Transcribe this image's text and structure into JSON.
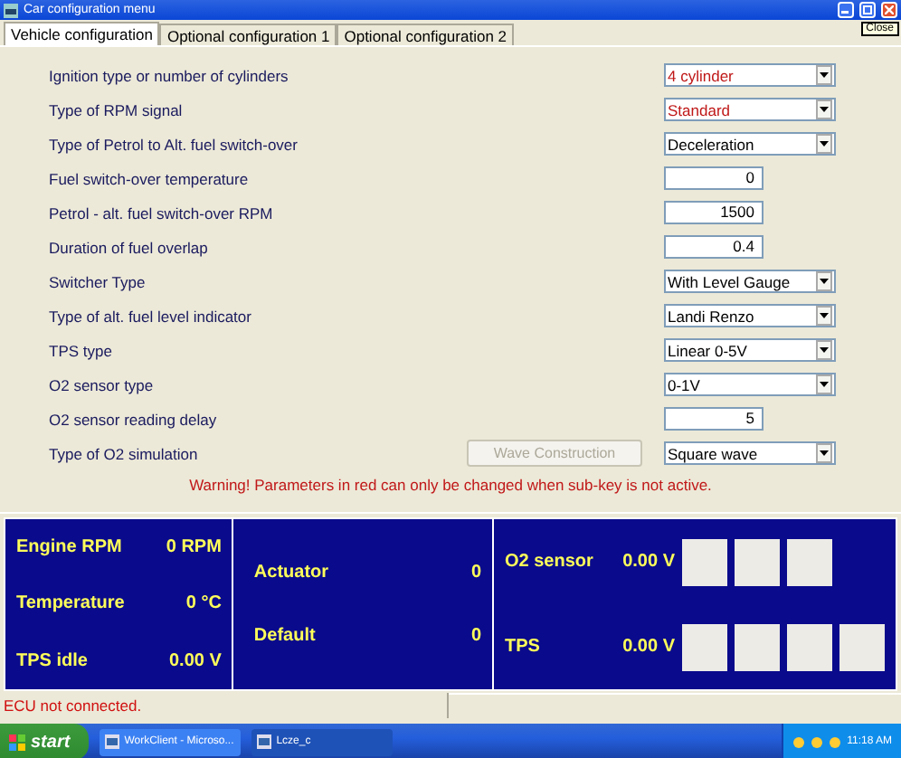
{
  "window": {
    "title": "Car configuration menu",
    "tooltip": "Close"
  },
  "tabs": [
    {
      "label": "Vehicle configuration",
      "selected": true
    },
    {
      "label": "Optional configuration 1",
      "selected": false
    },
    {
      "label": "Optional configuration 2",
      "selected": false
    }
  ],
  "parameters": [
    {
      "label": "Ignition type or number of cylinders",
      "kind": "select",
      "value": "4 cylinder",
      "locked": true
    },
    {
      "label": "Type of RPM signal",
      "kind": "select",
      "value": "Standard",
      "locked": true
    },
    {
      "label": "Type of Petrol to Alt. fuel switch-over",
      "kind": "select",
      "value": "Deceleration",
      "locked": false
    },
    {
      "label": "Fuel switch-over temperature",
      "kind": "number",
      "value": "0",
      "locked": false
    },
    {
      "label": "Petrol - alt. fuel switch-over RPM",
      "kind": "number",
      "value": "1500",
      "locked": false
    },
    {
      "label": "Duration of fuel overlap",
      "kind": "number",
      "value": "0.4",
      "locked": false
    },
    {
      "label": "Switcher Type",
      "kind": "select",
      "value": "With Level Gauge",
      "locked": false
    },
    {
      "label": "Type of alt. fuel level indicator",
      "kind": "select",
      "value": "Landi Renzo",
      "locked": false
    },
    {
      "label": "TPS type",
      "kind": "select",
      "value": "Linear 0-5V",
      "locked": false
    },
    {
      "label": "O2 sensor type",
      "kind": "select",
      "value": "0-1V",
      "locked": false
    },
    {
      "label": "O2 sensor reading delay",
      "kind": "number",
      "value": "5",
      "locked": false
    },
    {
      "label": "Type of O2 simulation",
      "kind": "select",
      "value": "Square wave",
      "locked": false,
      "button": {
        "label": "Wave Construction",
        "disabled": true
      }
    }
  ],
  "warning": "Warning! Parameters in red can only be changed when sub-key is not active.",
  "dashboard": {
    "engine": [
      {
        "label": "Engine RPM",
        "value": "0 RPM"
      },
      {
        "label": "Temperature",
        "value": "0 °C"
      },
      {
        "label": "TPS idle",
        "value": "0.00 V"
      }
    ],
    "status": [
      {
        "label": "Actuator",
        "value": "0"
      },
      {
        "label": "Default",
        "value": "0"
      }
    ],
    "sensors": [
      {
        "label": "O2 sensor",
        "value": "0.00 V",
        "indicators": [
          {
            "lit": false
          },
          {
            "lit": false
          },
          {
            "lit": false
          }
        ]
      },
      {
        "label": "TPS",
        "value": "0.00 V",
        "indicators": [
          {
            "lit": false
          },
          {
            "lit": false
          },
          {
            "lit": false
          },
          {
            "lit": false
          }
        ]
      }
    ]
  },
  "status_bar": {
    "message": "ECU not connected."
  },
  "taskbar": {
    "start": "start",
    "tasks": [
      {
        "label": "WorkClient - Microso...",
        "selected": false
      },
      {
        "label": "Lcze_c",
        "selected": true
      }
    ],
    "clock": "11:18 AM"
  }
}
